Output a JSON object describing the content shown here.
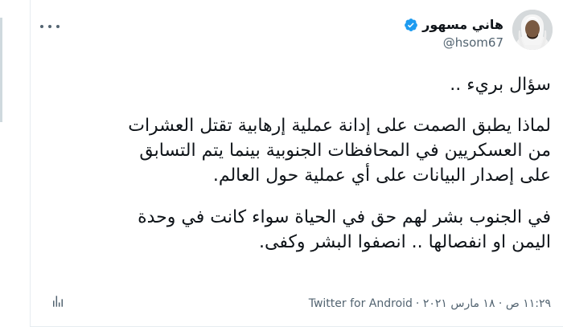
{
  "tweet": {
    "display_name": "هاني مسهور",
    "handle": "@hsom67",
    "verified": true,
    "paragraphs": [
      [
        "سؤال بريء .."
      ],
      [
        "لماذا يطبق الصمت على إدانة عملية إرهابية تقتل العشرات",
        "من العسكريين في المحافظات الجنوبية بينما يتم التسابق",
        "على إصدار البيانات على أي عملية حول العالم."
      ],
      [
        "في الجنوب بشر لهم حق في الحياة سواء كانت في وحدة",
        "اليمن او انفصالها .. انصفوا البشر وكفى."
      ]
    ],
    "time_text": "١١:٢٩ ص · ١٨ مارس ٢٠٢١ ·",
    "source": "Twitter for Android"
  },
  "icons": {
    "more": "more-horizontal-icon",
    "verified": "verified-badge-icon",
    "analytics": "analytics-icon"
  },
  "colors": {
    "verified": "#1d9bf0",
    "secondary_text": "#536471",
    "primary_text": "#0f1419"
  }
}
